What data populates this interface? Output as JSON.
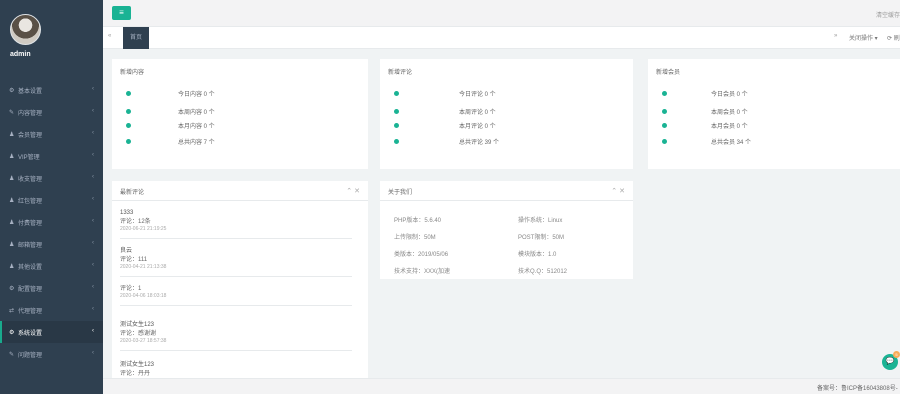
{
  "user": {
    "name": "admin"
  },
  "sidebar": {
    "items": [
      {
        "label": "基本设置",
        "icon": "gear-icon",
        "glyph": "⚙"
      },
      {
        "label": "内容管理",
        "icon": "edit-icon",
        "glyph": "✎"
      },
      {
        "label": "会员管理",
        "icon": "users-icon",
        "glyph": "♟"
      },
      {
        "label": "VIP管理",
        "icon": "user-icon",
        "glyph": "♟"
      },
      {
        "label": "收支管理",
        "icon": "user-icon",
        "glyph": "♟"
      },
      {
        "label": "红包管理",
        "icon": "user-icon",
        "glyph": "♟"
      },
      {
        "label": "付费管理",
        "icon": "user-icon",
        "glyph": "♟"
      },
      {
        "label": "邮箱管理",
        "icon": "user-icon",
        "glyph": "♟"
      },
      {
        "label": "其他设置",
        "icon": "user-icon",
        "glyph": "♟"
      },
      {
        "label": "配置管理",
        "icon": "gear-icon",
        "glyph": "⚙"
      },
      {
        "label": "代理管理",
        "icon": "exchange-icon",
        "glyph": "⇄"
      },
      {
        "label": "系统设置",
        "icon": "cogs-icon",
        "glyph": "⚙",
        "active": true
      },
      {
        "label": "问题管理",
        "icon": "edit-icon",
        "glyph": "✎"
      }
    ]
  },
  "topbar": {
    "menu_toggle_glyph": "≡",
    "clear_cache": "清空缓存"
  },
  "tabs": {
    "prev_glyph": "«",
    "home": "首页",
    "next_glyph": "»",
    "ops": "关闭操作 ▾",
    "refresh": "⟳ 刷"
  },
  "stats": {
    "content": {
      "title": "新增内容",
      "rows": [
        "今日内容 0 个",
        "本周内容 0 个",
        "本月内容 0 个",
        "总共内容 7 个"
      ]
    },
    "comments": {
      "title": "新增评论",
      "rows": [
        "今日评论 0 个",
        "本周评论 0 个",
        "本月评论 0 个",
        "总共评论 39 个"
      ]
    },
    "members": {
      "title": "新增会员",
      "rows": [
        "今日会员 0 个",
        "本周会员 0 个",
        "本月会员 0 个",
        "总共会员 34 个"
      ]
    }
  },
  "recent_comments": {
    "title": "最新评论",
    "items": [
      {
        "name": "1333",
        "text": "评论：12条",
        "time": "2020-06-21 21:19:25"
      },
      {
        "name": "良云",
        "text": "评论：111",
        "time": "2020-04-21 21:13:38"
      },
      {
        "name": "",
        "text": "评论：1",
        "time": "2020-04-06 18:03:18"
      },
      {
        "name": "测试女生123",
        "text": "评论：感谢谢",
        "time": "2020-03-27 18:57:38"
      },
      {
        "name": "测试女生123",
        "text": "评论：丹丹",
        "time": ""
      }
    ]
  },
  "system_info": {
    "title": "关于我们",
    "items": [
      "PHP版本：5.6.40",
      "操作系统：Linux",
      "上传限制：50M",
      "POST限制：50M",
      "类版本：2019/05/06",
      "模块版本：1.0",
      "技术支持：XXX(加速",
      "技术Q.Q：512012"
    ]
  },
  "chat": {
    "glyph": "💬",
    "count": "5"
  },
  "footer": {
    "icp": "备案号：鲁ICP备16043808号-"
  }
}
